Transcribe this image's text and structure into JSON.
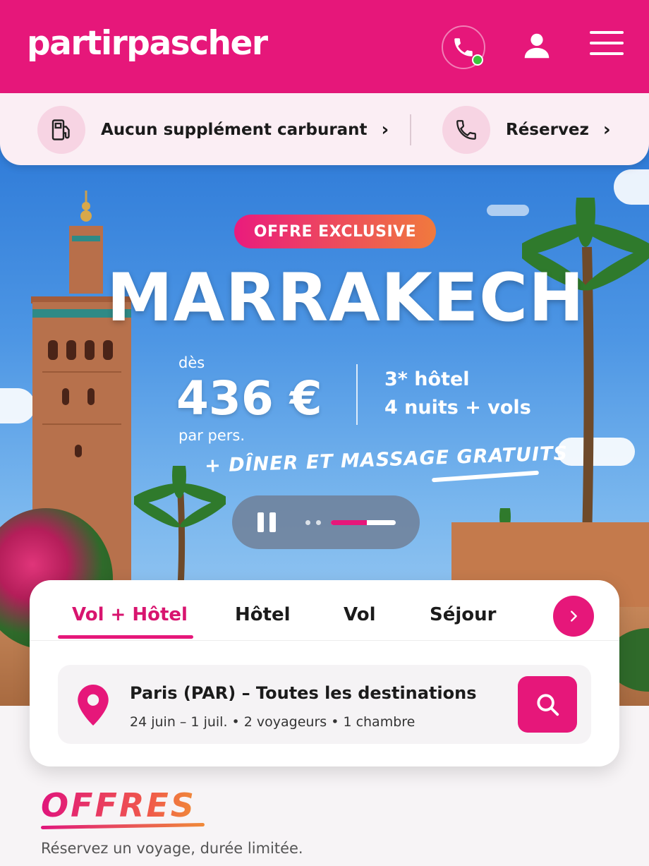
{
  "header": {
    "logo": "partirpascher",
    "icons": [
      "phone-icon",
      "user-icon",
      "menu-icon"
    ],
    "brand_color": "#e6177a",
    "status_color": "#3cc43c"
  },
  "infobar": {
    "fuel_label": "Aucun supplément carburant",
    "book_label": "Réservez"
  },
  "hero": {
    "badge": "OFFRE EXCLUSIVE",
    "destination": "MARRAKECH",
    "from_label": "dès",
    "price": "436 €",
    "per_person": "par pers.",
    "details_line1": "3* hôtel",
    "details_line2": "4 nuits + vols",
    "extras": "+ DÎNER ET MASSAGE GRATUITS",
    "carousel": {
      "slide_count": 3,
      "current_slide": 3,
      "progress": 0.55
    }
  },
  "search": {
    "tabs": [
      "Vol + Hôtel",
      "Hôtel",
      "Vol",
      "Séjour"
    ],
    "active_tab": "Vol + Hôtel",
    "route": "Paris (PAR) – Toutes les destinations",
    "details": "24 juin – 1 juil. • 2 voyageurs • 1 chambre"
  },
  "offers": {
    "title": "OFFRES",
    "subtitle": "Réservez un voyage, durée limitée."
  }
}
